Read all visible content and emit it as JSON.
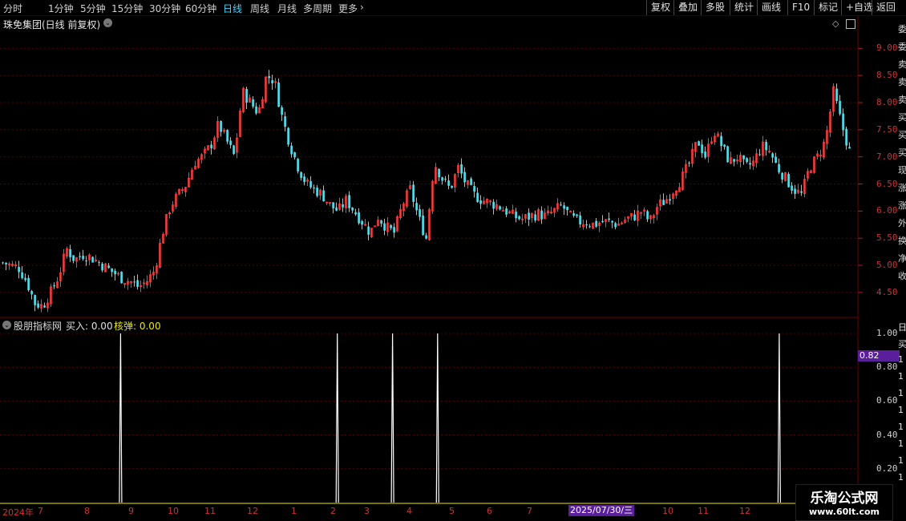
{
  "toolbar": {
    "periods": [
      "分时",
      "1分钟",
      "5分钟",
      "15分钟",
      "30分钟",
      "60分钟",
      "日线",
      "周线",
      "月线",
      "多周期",
      "更多"
    ],
    "active_period": "日线",
    "buttons": [
      "复权",
      "叠加",
      "多股",
      "统计",
      "画线",
      "F10",
      "标记",
      "+自选",
      "返回"
    ]
  },
  "main_chart": {
    "title": "珠免集团(日线 前复权)",
    "price_ticks": [
      "9.00",
      "8.50",
      "8.00",
      "7.50",
      "7.00",
      "6.50",
      "6.00",
      "5.50",
      "5.00",
      "4.50"
    ]
  },
  "indicator": {
    "name": "股朋指标网",
    "buy_label": "买入: 0.00",
    "hedan_label": "核弹: 0.00",
    "ticks": [
      "1.00",
      "0.80",
      "0.60",
      "0.40",
      "0.20"
    ],
    "current_value": "0.82"
  },
  "date_axis": {
    "labels": [
      "2024年",
      "7",
      "8",
      "9",
      "10",
      "11",
      "12",
      "1",
      "2",
      "3",
      "4",
      "5",
      "6",
      "7",
      "10",
      "11",
      "12"
    ],
    "cursor_date": "2025/07/30/三"
  },
  "watermark": {
    "title": "乐淘公式网",
    "url": "www.60lt.com"
  },
  "side_strip_top": [
    "委",
    "委",
    "卖",
    "卖",
    "卖",
    "买",
    "买",
    "买",
    "现",
    "涨",
    "涨",
    "外",
    "换",
    "净",
    "收"
  ],
  "side_strip_bottom": [
    "日",
    "买",
    "1",
    "1",
    "1",
    "1",
    "1",
    "1",
    "1",
    "1"
  ],
  "colors": {
    "up": "#ff3b3b",
    "down": "#4fe3f0",
    "signal": "#ffffff",
    "grid": "#4a0000",
    "accent": "#5b1f9e"
  },
  "chart_data": [
    {
      "type": "candlestick",
      "title": "珠免集团(日线 前复权)",
      "yticks": [
        9.0,
        8.5,
        8.0,
        7.5,
        7.0,
        6.5,
        6.0,
        5.5,
        5.0,
        4.5
      ],
      "ylim": [
        4.1,
        9.3
      ],
      "x_labels": [
        "2024年",
        "7",
        "8",
        "9",
        "10",
        "11",
        "12",
        "1",
        "2",
        "3",
        "4",
        "5",
        "6",
        "7",
        "10",
        "11",
        "12"
      ],
      "close_path": [
        5.05,
        5.0,
        4.95,
        4.7,
        4.3,
        4.25,
        4.5,
        4.8,
        5.3,
        5.1,
        5.2,
        5.15,
        5.05,
        4.95,
        4.85,
        4.75,
        4.7,
        4.6,
        4.7,
        4.9,
        5.6,
        6.1,
        6.3,
        6.5,
        6.9,
        7.0,
        7.2,
        7.6,
        7.3,
        7.0,
        8.2,
        8.0,
        7.8,
        8.5,
        8.4,
        7.7,
        7.2,
        6.8,
        6.5,
        6.4,
        6.3,
        6.1,
        6.0,
        6.2,
        6.0,
        5.8,
        5.6,
        5.9,
        5.7,
        5.6,
        6.1,
        6.4,
        5.9,
        5.5,
        6.9,
        6.6,
        6.4,
        6.8,
        6.5,
        6.3,
        6.2,
        6.15,
        6.1,
        6.0,
        5.9,
        5.85,
        5.9,
        5.95,
        5.9,
        6.0,
        6.1,
        5.9,
        5.8,
        5.8,
        5.75,
        5.8,
        5.8,
        5.75,
        5.85,
        5.9,
        6.0,
        5.8,
        6.1,
        6.2,
        6.4,
        6.6,
        6.9,
        7.3,
        7.0,
        7.5,
        7.2,
        6.9,
        7.0,
        6.8,
        6.9,
        7.2,
        7.1,
        6.8,
        6.6,
        6.4,
        6.3,
        6.8,
        7.0,
        7.3,
        8.2,
        7.6,
        7.1
      ]
    },
    {
      "type": "line",
      "title": "股朋指标网",
      "yticks": [
        1.0,
        0.8,
        0.6,
        0.4,
        0.2
      ],
      "ylim": [
        0,
        1.0
      ],
      "series": [
        {
          "name": "买入",
          "spikes_at_fraction": [
            0.14,
            0.395,
            0.46,
            0.513,
            0.915
          ],
          "spike_value": 1.0
        }
      ]
    }
  ]
}
